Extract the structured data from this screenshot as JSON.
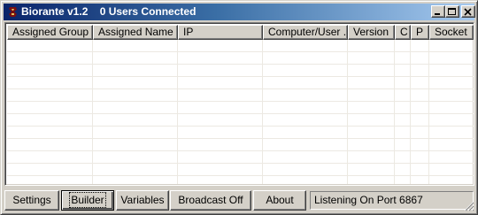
{
  "window": {
    "title": "Biorante v1.2    0 Users Connected",
    "controls": {
      "minimize": "minimize-icon",
      "maximize": "maximize-icon",
      "close": "close-icon"
    }
  },
  "listview": {
    "columns": [
      "Assigned Group",
      "Assigned Name",
      "IP",
      "Computer/User ...",
      "Version",
      "C",
      "P",
      "Socket"
    ],
    "rows": []
  },
  "buttons": {
    "settings": "Settings",
    "builder": "Builder",
    "variables": "Variables",
    "broadcast": "Broadcast Off",
    "about": "About"
  },
  "status": {
    "text": "Listening On Port 6867"
  },
  "colors": {
    "title_start": "#0a246a",
    "title_end": "#a6caf0",
    "face": "#d4d0c8"
  }
}
